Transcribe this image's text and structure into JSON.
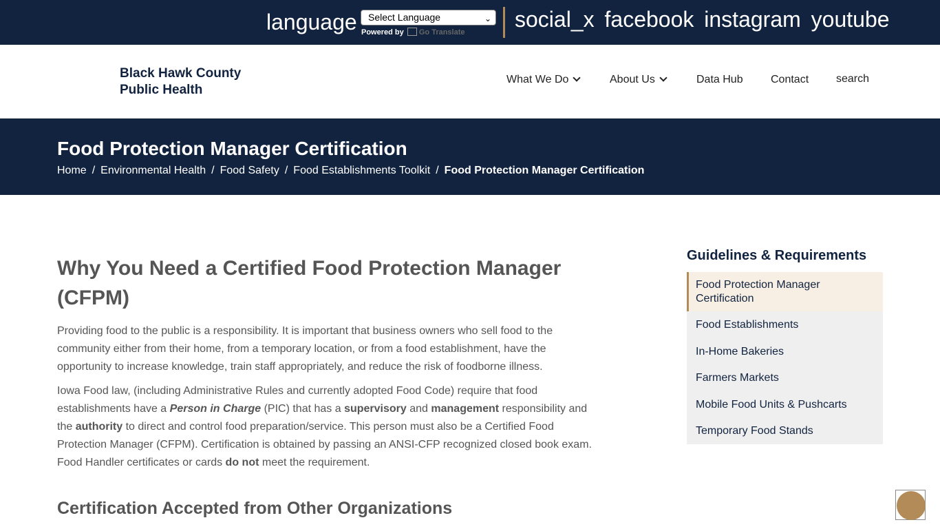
{
  "topbar": {
    "language_label": "language",
    "select_value": "Select Language",
    "powered_by": "Powered by",
    "translate_label": "Go Translate",
    "social": [
      "social_x",
      "facebook",
      "instagram",
      "youtube"
    ]
  },
  "header": {
    "logo_line1": "Black Hawk County",
    "logo_line2": "Public Health",
    "nav": [
      "What We Do",
      "About Us",
      "Data Hub",
      "Contact",
      "search"
    ]
  },
  "hero": {
    "title": "Food Protection Manager Certification",
    "breadcrumbs": [
      "Home",
      "Environmental Health",
      "Food Safety",
      "Food Establishments Toolkit",
      "Food Protection Manager Certification"
    ]
  },
  "main": {
    "heading": "Why You Need a Certified Food Protection Manager (CFPM)",
    "para1": "Providing food to the public is a responsibility. It is important that business owners who sell food to the community either from their home, from a temporary location, or from a food establishment, have the opportunity to increase knowledge, train staff appropriately, and reduce the risk of foodborne illness.",
    "para2": {
      "t1": "Iowa Food law, (including Administrative Rules and currently adopted Food Code) require that food establishments have a ",
      "b1": "Person in Charge",
      "t2": " (PIC) that has a ",
      "b2": "supervisory",
      "t3": " and ",
      "b3": "management",
      "t4": " responsibility and the ",
      "b4": "authority",
      "t5": " to direct and control food preparation/service. This person must also be a Certified Food Protection Manager (CFPM). Certification is obtained by passing an ANSI-CFP recognized closed book exam. Food Handler certificates or cards ",
      "b5": "do not",
      "t6": " meet the requirement."
    },
    "subheading": "Certification Accepted from Other Organizations"
  },
  "sidebar": {
    "title": "Guidelines & Requirements",
    "items": [
      "Food Protection Manager Certification",
      "Food Establishments",
      "In-Home Bakeries",
      "Farmers Markets",
      "Mobile Food Units & Pushcarts",
      "Temporary Food Stands"
    ]
  },
  "colors": {
    "navy": "#12233f",
    "accent": "#b28b58",
    "sidebar_bg": "#efefef",
    "active_bg": "#f7efe4"
  }
}
